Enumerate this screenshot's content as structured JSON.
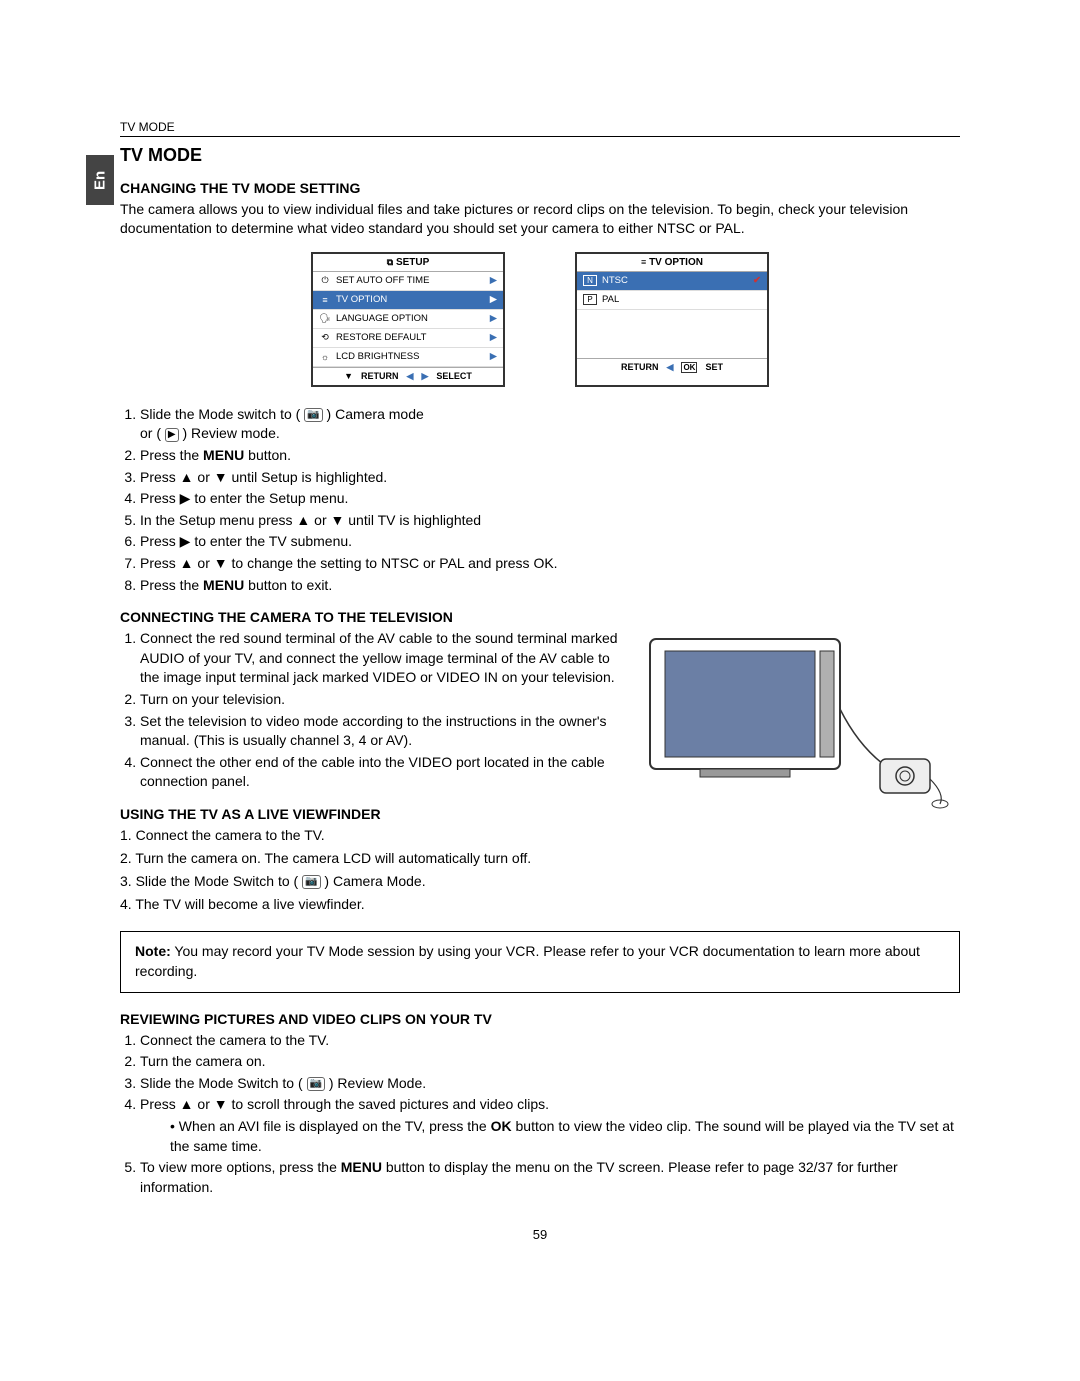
{
  "header": {
    "section_label": "TV MODE",
    "lang_tab": "En"
  },
  "title": "TV MODE",
  "page_number": "59",
  "section1": {
    "heading": "CHANGING THE TV MODE SETTING",
    "intro": "The camera allows you to view individual files and take pictures or record clips on the television. To begin, check your television documentation to determine what video standard you should set your camera to either NTSC or PAL.",
    "setup_box": {
      "title": "SETUP",
      "items": [
        {
          "icon": "⏻",
          "label": "SET AUTO OFF TIME"
        },
        {
          "icon": "≡",
          "label": "TV OPTION",
          "selected": true
        },
        {
          "icon": "🗣",
          "label": "LANGUAGE OPTION"
        },
        {
          "icon": "⟲",
          "label": "RESTORE DEFAULT"
        },
        {
          "icon": "☼",
          "label": "LCD BRIGHTNESS"
        }
      ],
      "footer_left": "RETURN",
      "footer_right": "SELECT"
    },
    "option_box": {
      "title": "TV  OPTION",
      "items": [
        {
          "icon": "N",
          "label": "NTSC",
          "selected": true,
          "tick": true
        },
        {
          "icon": "P",
          "label": "PAL"
        }
      ],
      "footer_left": "RETURN",
      "footer_right": "SET",
      "footer_right_prefix": "OK"
    },
    "steps": [
      "Slide the Mode switch to ( 📷 ) Camera mode or ( ▶ ) Review mode.",
      "Press the MENU button.",
      "Press ▲ or ▼ until Setup is highlighted.",
      "Press ▶ to enter the Setup menu.",
      "In the Setup menu press ▲ or ▼ until TV is highlighted",
      "Press ▶ to enter the TV submenu.",
      "Press ▲ or ▼ to change the setting to NTSC or PAL and press OK.",
      "Press the MENU button to exit."
    ],
    "step2_pre": "Press the ",
    "step2_bold": "MENU",
    "step2_post": " button.",
    "step8_pre": "Press the ",
    "step8_bold": "MENU",
    "step8_post": " button to exit."
  },
  "section2": {
    "heading": "CONNECTING THE CAMERA TO THE TELEVISION",
    "steps": [
      "Connect the red sound terminal of the AV cable to the sound terminal marked AUDIO of your TV, and connect the yellow image terminal of the AV cable to the image input terminal jack marked VIDEO or VIDEO IN on your television.",
      "Turn on your television.",
      "Set the television to video mode according to the instructions in the owner's manual. (This is usually channel 3, 4 or AV).",
      "Connect the other end of the cable into the VIDEO port located in the cable connection panel."
    ]
  },
  "section3": {
    "heading": "USING THE TV AS A LIVE VIEWFINDER",
    "steps": [
      "Connect the camera to the TV.",
      "Turn the camera on. The camera LCD will automatically turn off.",
      "Slide the Mode Switch to ( 📷 ) Camera Mode.",
      "The TV will become a live viewfinder."
    ]
  },
  "note": {
    "prefix": "Note:",
    "text": " You may record your TV Mode session by using your VCR. Please refer to your VCR documentation to learn more about recording."
  },
  "section4": {
    "heading": "REVIEWING PICTURES AND VIDEO CLIPS ON YOUR TV",
    "steps": [
      "Connect the camera to the TV.",
      "Turn the camera on.",
      "Slide the Mode Switch to ( 📷 ) Review Mode.",
      "Press ▲ or ▼ to scroll through the saved pictures and video clips."
    ],
    "sub_pre": "When an AVI file is displayed on the TV, press the ",
    "sub_bold": "OK",
    "sub_post": " button to view the video clip. The sound will be played via the TV set at the same time.",
    "step5_pre": "To view more options, press the ",
    "step5_bold": "MENU",
    "step5_post": " button to display the menu on the TV screen. Please refer to page 32/37 for further information."
  }
}
